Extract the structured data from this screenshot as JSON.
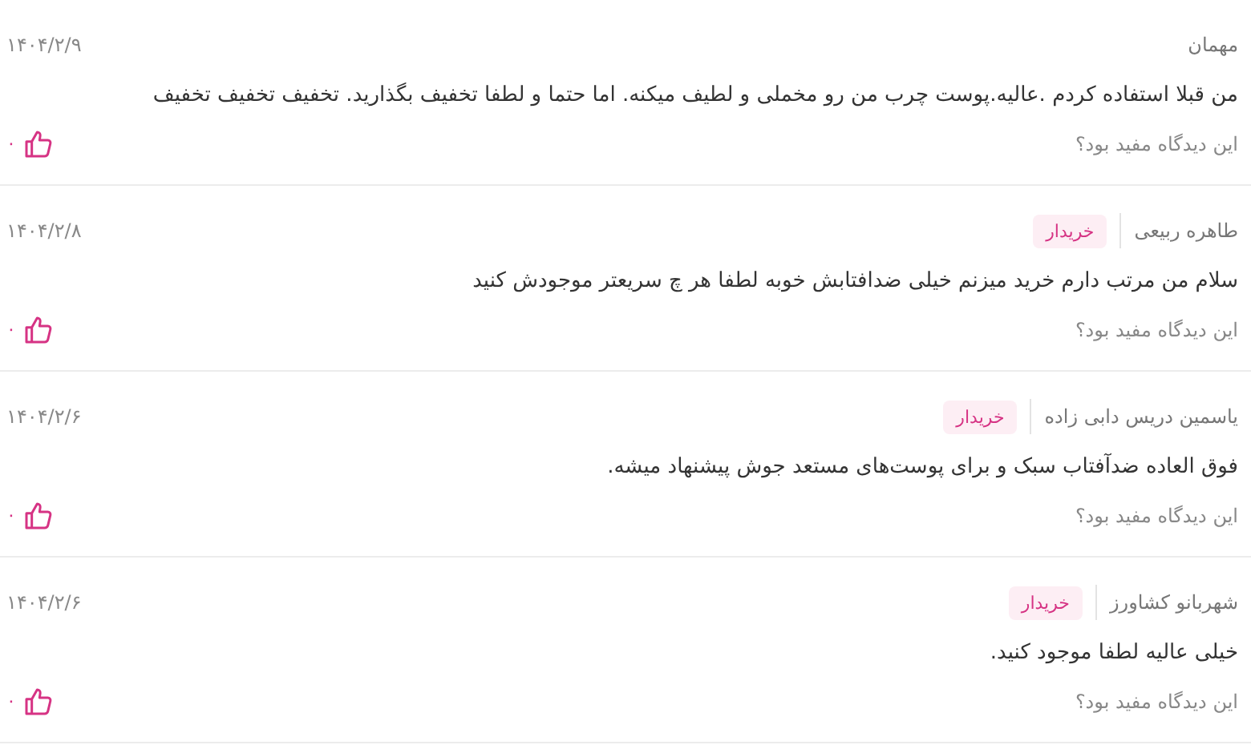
{
  "reviews": [
    {
      "author": "مهمان",
      "date": "۱۴۰۴/۲/۹",
      "comment": "من قبلا استفاده کردم .عالیه.پوست چرب من رو مخملی و لطیف میکنه. اما حتما و لطفا تخفیف بگذارید. تخفیف تخفیف تخفیف",
      "helpful_prompt": "این دیدگاه مفید بود؟",
      "likes": "۰"
    },
    {
      "author": "طاهره ربیعی",
      "badge": "خریدار",
      "date": "۱۴۰۴/۲/۸",
      "comment": "سلام من مرتب دارم خرید میزنم خیلی ضدافتابش خوبه لطفا هر چ سریعتر موجودش کنید",
      "helpful_prompt": "این دیدگاه مفید بود؟",
      "likes": "۰"
    },
    {
      "author": "یاسمین دریس دابی زاده",
      "badge": "خریدار",
      "date": "۱۴۰۴/۲/۶",
      "comment": "فوق العاده ضدآفتاب سبک و برای پوست‌های مستعد جوش پیشنهاد میشه.",
      "helpful_prompt": "این دیدگاه مفید بود؟",
      "likes": "۰"
    },
    {
      "author": "شهربانو کشاورز",
      "badge": "خریدار",
      "date": "۱۴۰۴/۲/۶",
      "comment": "خیلی عالیه لطفا موجود کنید.",
      "helpful_prompt": "این دیدگاه مفید بود؟",
      "likes": "۰"
    }
  ]
}
